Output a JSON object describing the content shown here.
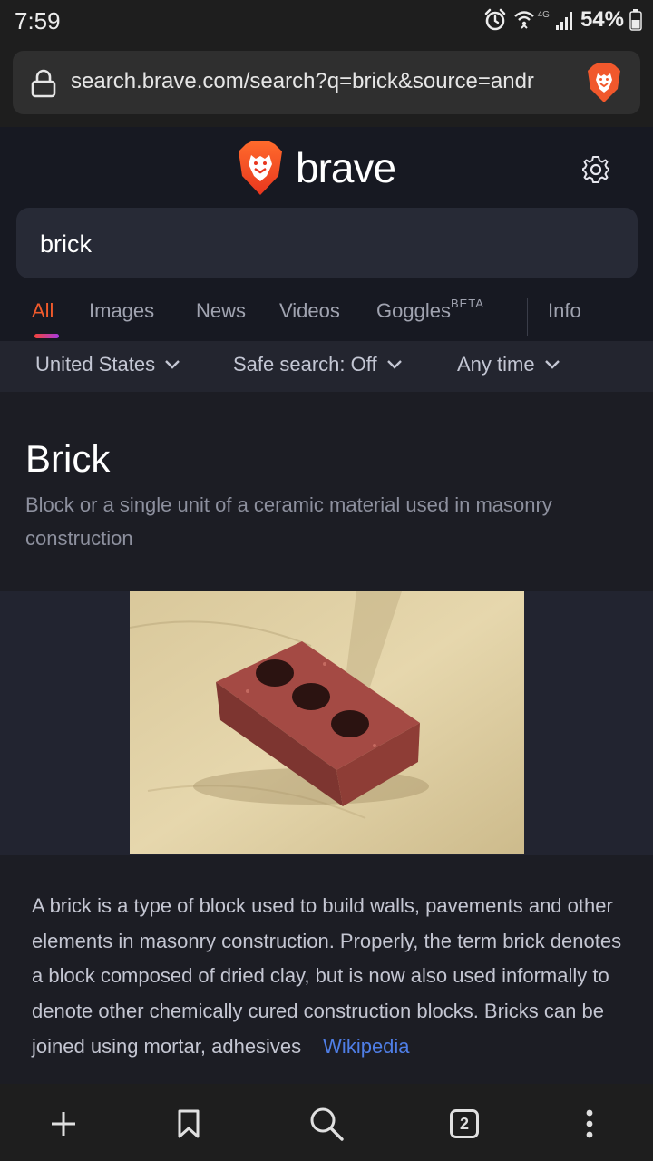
{
  "status_bar": {
    "time": "7:59",
    "battery": "54%",
    "network": "4G",
    "icons": [
      "alarm-icon",
      "wifi-icon",
      "signal-icon",
      "battery-icon"
    ]
  },
  "browser": {
    "url": "search.brave.com/search?q=brick&source=andr"
  },
  "header": {
    "logo_text": "brave"
  },
  "search": {
    "query": "brick"
  },
  "tabs": {
    "all": "All",
    "images": "Images",
    "news": "News",
    "videos": "Videos",
    "goggles": "Goggles",
    "goggles_badge": "BETA",
    "info": "Info"
  },
  "filters": {
    "region": "United States",
    "safe_search": "Safe search: Off",
    "time": "Any time"
  },
  "infobox": {
    "title": "Brick",
    "subtitle": "Block or a single unit of a ceramic material used in masonry construction",
    "description": "A brick is a type of block used to build walls, pavements and other elements in masonry construction. Properly, the term brick denotes a block composed of dried clay, but is now also used informally to denote other chemically cured construction blocks. Bricks can be joined using mortar, adhesives",
    "source_link": "Wikipedia"
  },
  "bottom_bar": {
    "tab_count": "2"
  },
  "colors": {
    "accent": "#f05a2c",
    "link": "#4f7ee6",
    "page_bg": "#1c1d24"
  }
}
